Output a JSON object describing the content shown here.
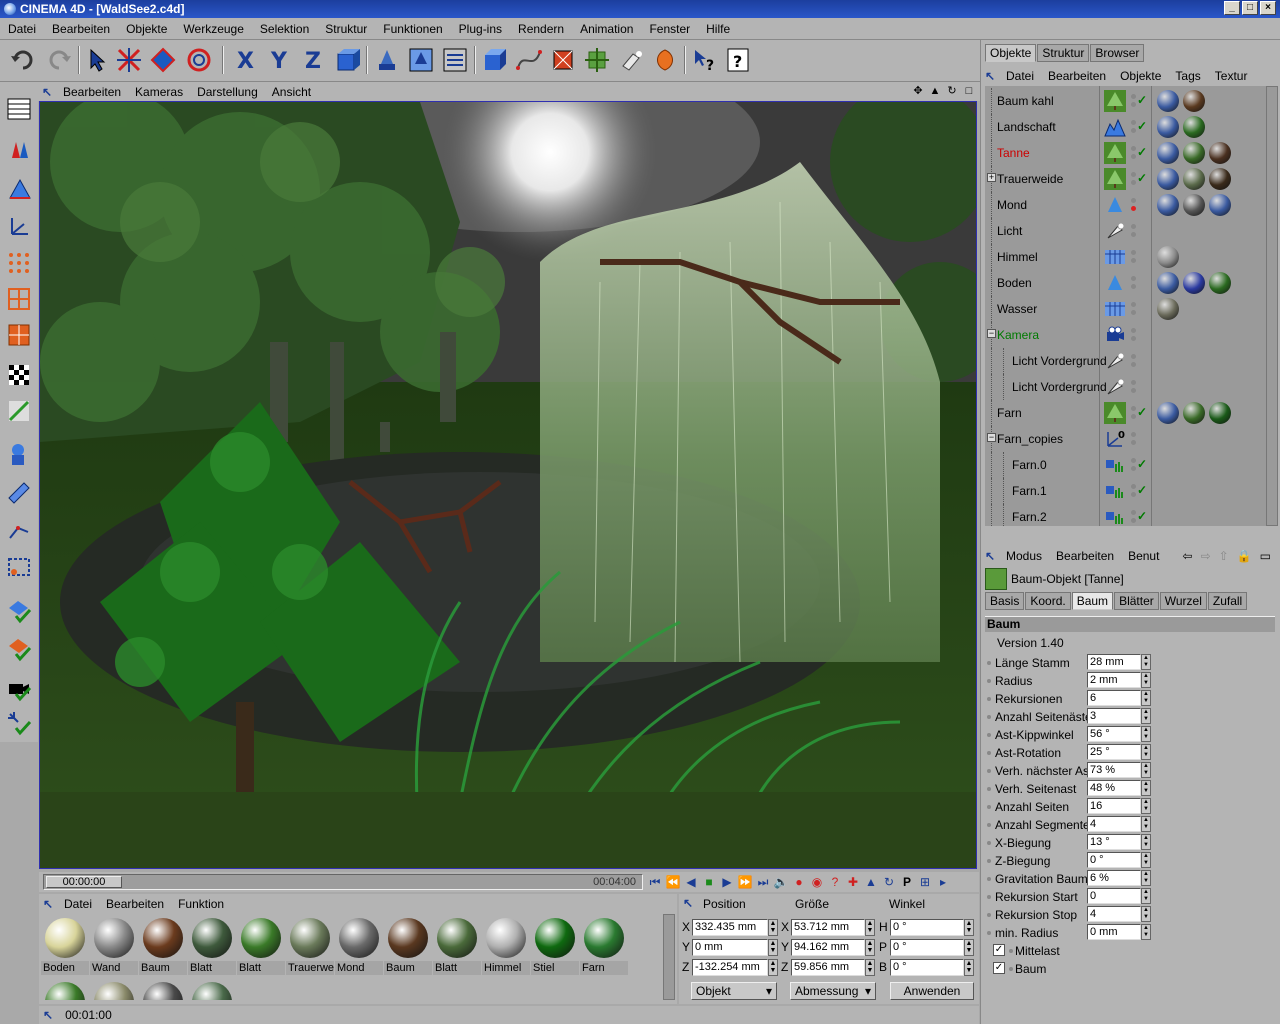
{
  "window": {
    "title": "CINEMA 4D - [WaldSee2.c4d]",
    "buttons": [
      "_",
      "□",
      "×"
    ]
  },
  "menubar": [
    "Datei",
    "Bearbeiten",
    "Objekte",
    "Werkzeuge",
    "Selektion",
    "Struktur",
    "Funktionen",
    "Plug-ins",
    "Rendern",
    "Animation",
    "Fenster",
    "Hilfe"
  ],
  "toolbar_icons": [
    "undo-icon",
    "redo-icon",
    "select-pointer-icon",
    "move-icon",
    "scale-icon",
    "rotate-icon",
    "x-axis-icon",
    "y-axis-icon",
    "z-axis-icon",
    "coordinate-system-icon",
    "render-view-icon",
    "render-picture-viewer-icon",
    "render-settings-icon",
    "cube-primitive-icon",
    "spline-icon",
    "nurbs-icon",
    "deformer-icon",
    "scene-icon",
    "light-icon",
    "tag-icon",
    "help-pointer-icon",
    "help-icon"
  ],
  "viewport": {
    "menu": [
      "Bearbeiten",
      "Kameras",
      "Darstellung",
      "Ansicht"
    ]
  },
  "timeline": {
    "current": "00:00:00",
    "end": "00:04:00"
  },
  "materials": {
    "menu": [
      "Datei",
      "Bearbeiten",
      "Funktion"
    ],
    "items": [
      {
        "label": "Boden",
        "color": "#d8d49a"
      },
      {
        "label": "Wand",
        "color": "#8a8a8a"
      },
      {
        "label": "Baum",
        "color": "#6b3b1e"
      },
      {
        "label": "Blatt",
        "color": "#3e5a3c"
      },
      {
        "label": "Blatt",
        "color": "#3a7a28"
      },
      {
        "label": "Trauerwe",
        "color": "#6a7a5a"
      },
      {
        "label": "Mond",
        "color": "#6a6a6a"
      },
      {
        "label": "Baum",
        "color": "#5a3820"
      },
      {
        "label": "Blatt",
        "color": "#4a6a3a"
      },
      {
        "label": "Himmel",
        "color": "#b0b0b0"
      },
      {
        "label": "Stiel",
        "color": "#0f6a10"
      },
      {
        "label": "Farn",
        "color": "#2a7a30"
      }
    ]
  },
  "coordinates": {
    "headers": [
      "Position",
      "Größe",
      "Winkel"
    ],
    "rows": [
      {
        "axis": "X",
        "pos": "332.435 mm",
        "size_axis": "X",
        "size": "53.712 mm",
        "rot_axis": "H",
        "rot": "0 °"
      },
      {
        "axis": "Y",
        "pos": "0 mm",
        "size_axis": "Y",
        "size": "94.162 mm",
        "rot_axis": "P",
        "rot": "0 °"
      },
      {
        "axis": "Z",
        "pos": "-132.254 mm",
        "size_axis": "Z",
        "size": "59.856 mm",
        "rot_axis": "B",
        "rot": "0 °"
      }
    ],
    "mode": "Objekt",
    "size_mode": "Abmessung",
    "apply": "Anwenden"
  },
  "status": {
    "time": "00:01:00"
  },
  "object_manager": {
    "tabs": [
      "Objekte",
      "Struktur",
      "Browser"
    ],
    "menu": [
      "Datei",
      "Bearbeiten",
      "Objekte",
      "Tags",
      "Textur"
    ],
    "objects": [
      {
        "name": "Baum kahl",
        "indent": 0,
        "expand": "",
        "color": "#000000",
        "icon": "tree-icon",
        "dot": "#888888",
        "check": "✓",
        "tags": [
          "#3a5aa0",
          "#5a3a20",
          ""
        ]
      },
      {
        "name": "Landschaft",
        "indent": 0,
        "expand": "",
        "color": "#000000",
        "icon": "landscape-icon",
        "dot": "#888888",
        "check": "✓",
        "tags": [
          "#3a5aa0",
          "#2a6a20",
          ""
        ]
      },
      {
        "name": "Tanne",
        "indent": 0,
        "expand": "",
        "color": "#cc0000",
        "icon": "tree-icon",
        "dot": "#888888",
        "check": "✓",
        "tags": [
          "#3a5aa0",
          "#3a6a28",
          "#4a3020"
        ]
      },
      {
        "name": "Trauerweide",
        "indent": 0,
        "expand": "+",
        "color": "#000000",
        "icon": "tree-icon",
        "dot": "#888888",
        "check": "✓",
        "tags": [
          "#3a5aa0",
          "#5a6a4a",
          "#3a2a1a"
        ]
      },
      {
        "name": "Mond",
        "indent": 0,
        "expand": "",
        "color": "#000000",
        "icon": "sphere-icon",
        "dot": "#dd2222",
        "check": "",
        "tags": [
          "#3a5aa0",
          "#555555",
          "#3a5aa0"
        ]
      },
      {
        "name": "Licht",
        "indent": 0,
        "expand": "",
        "color": "#000000",
        "icon": "light-icon",
        "dot": "#888888",
        "check": "",
        "tags": [
          "",
          "",
          ""
        ]
      },
      {
        "name": "Himmel",
        "indent": 0,
        "expand": "",
        "color": "#000000",
        "icon": "sky-icon",
        "dot": "#888888",
        "check": "",
        "tags": [
          "#8a8a8a",
          "",
          ""
        ]
      },
      {
        "name": "Boden",
        "indent": 0,
        "expand": "",
        "color": "#000000",
        "icon": "floor-icon",
        "dot": "#888888",
        "check": "",
        "tags": [
          "#3a5aa0",
          "#2a3aa0",
          "#2a6a20"
        ]
      },
      {
        "name": "Wasser",
        "indent": 0,
        "expand": "",
        "color": "#000000",
        "icon": "sky-icon",
        "dot": "#888888",
        "check": "",
        "tags": [
          "#6a6a5a",
          "",
          ""
        ]
      },
      {
        "name": "Kamera",
        "indent": 0,
        "expand": "−",
        "color": "#007a00",
        "icon": "camera-icon",
        "dot": "#888888",
        "check": "",
        "tags": [
          "",
          "",
          ""
        ]
      },
      {
        "name": "Licht Vordergrund",
        "indent": 1,
        "expand": "",
        "color": "#000000",
        "icon": "light-icon",
        "dot": "#888888",
        "check": "",
        "tags": [
          "",
          "",
          ""
        ]
      },
      {
        "name": "Licht Vordergrund",
        "indent": 1,
        "expand": "",
        "color": "#000000",
        "icon": "light-icon",
        "dot": "#888888",
        "check": "",
        "tags": [
          "",
          "",
          ""
        ]
      },
      {
        "name": "Farn",
        "indent": 0,
        "expand": "",
        "color": "#000000",
        "icon": "tree-icon",
        "dot": "#888888",
        "check": "✓",
        "tags": [
          "#3a5aa0",
          "#3a6a28",
          "#1a5a18"
        ]
      },
      {
        "name": "Farn_copies",
        "indent": 0,
        "expand": "−",
        "color": "#000000",
        "icon": "null-icon",
        "dot": "#888888",
        "check": "",
        "tags": [
          "",
          "",
          ""
        ]
      },
      {
        "name": "Farn.0",
        "indent": 1,
        "expand": "",
        "color": "#000000",
        "icon": "instance-icon",
        "dot": "#888888",
        "check": "✓",
        "tags": [
          "",
          "",
          ""
        ]
      },
      {
        "name": "Farn.1",
        "indent": 1,
        "expand": "",
        "color": "#000000",
        "icon": "instance-icon",
        "dot": "#888888",
        "check": "✓",
        "tags": [
          "",
          "",
          ""
        ]
      },
      {
        "name": "Farn.2",
        "indent": 1,
        "expand": "",
        "color": "#000000",
        "icon": "instance-icon",
        "dot": "#888888",
        "check": "✓",
        "tags": [
          "",
          "",
          ""
        ]
      }
    ]
  },
  "attribute_manager": {
    "menu": [
      "Modus",
      "Bearbeiten",
      "Benut"
    ],
    "object_title": "Baum-Objekt [Tanne]",
    "tabs": [
      "Basis",
      "Koord.",
      "Baum",
      "Blätter",
      "Wurzel",
      "Zufall"
    ],
    "active_tab": "Baum",
    "section": "Baum",
    "version": "Version 1.40",
    "params": [
      {
        "label": "Länge Stamm",
        "value": "28 mm"
      },
      {
        "label": "Radius",
        "value": "2 mm"
      },
      {
        "label": "Rekursionen",
        "value": "6"
      },
      {
        "label": "Anzahl Seitenäste",
        "value": "3"
      },
      {
        "label": "Ast-Kippwinkel",
        "value": "56 °"
      },
      {
        "label": "Ast-Rotation",
        "value": "25 °"
      },
      {
        "label": "Verh. nächster Ast",
        "value": "73 %"
      },
      {
        "label": "Verh. Seitenast",
        "value": "48 %"
      },
      {
        "label": "Anzahl Seiten",
        "value": "16"
      },
      {
        "label": "Anzahl Segmente",
        "value": "4"
      },
      {
        "label": "X-Biegung",
        "value": "13 °"
      },
      {
        "label": "Z-Biegung",
        "value": "0 °"
      },
      {
        "label": "Gravitation Baum",
        "value": "6 %"
      },
      {
        "label": "Rekursion Start",
        "value": "0"
      },
      {
        "label": "Rekursion Stop",
        "value": "4"
      },
      {
        "label": "min. Radius",
        "value": "0 mm"
      }
    ],
    "checks": [
      {
        "label": "Mittelast",
        "checked": "✓"
      },
      {
        "label": "Baum",
        "checked": "✓"
      }
    ]
  }
}
